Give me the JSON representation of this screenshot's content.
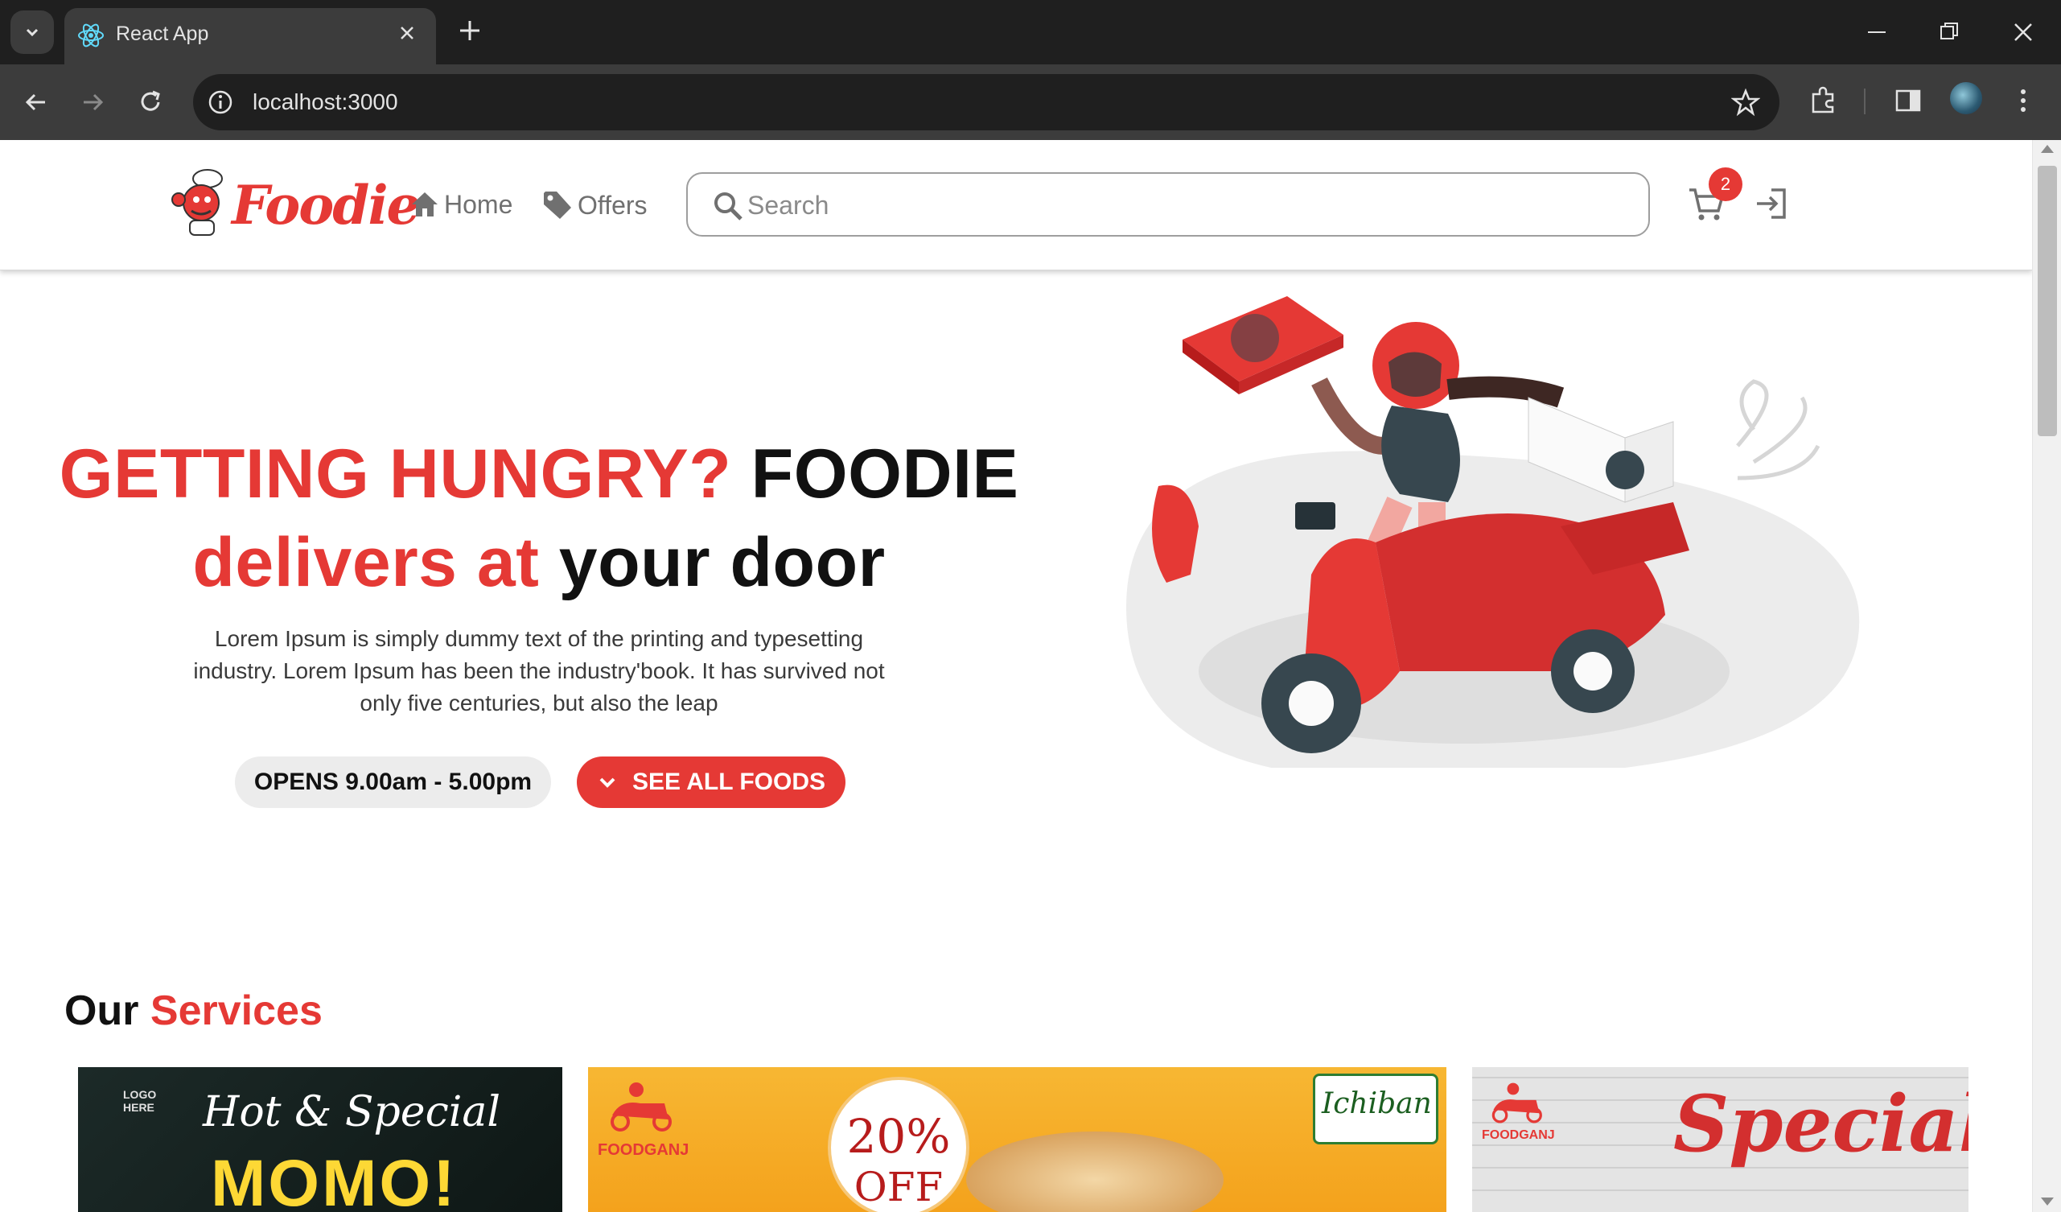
{
  "browser": {
    "tab_title": "React App",
    "url": "localhost:3000"
  },
  "header": {
    "logo_text": "Foodie",
    "nav": [
      {
        "label": "Home",
        "icon": "home-icon"
      },
      {
        "label": "Offers",
        "icon": "tag-icon"
      }
    ],
    "search_placeholder": "Search",
    "cart_count": "2"
  },
  "hero": {
    "title_red_1": "GETTING HUNGRY?",
    "title_black_1": "FOODIE",
    "title_red_2": "delivers at",
    "title_black_2": "your door",
    "description": "Lorem Ipsum is simply dummy text of the printing and typesetting industry. Lorem Ipsum has been the industry'book. It has survived not only five centuries, but also the leap",
    "opens_label": "OPENS 9.00am - 5.00pm",
    "see_all_label": "SEE ALL FOODS"
  },
  "services": {
    "title_black": "Our",
    "title_red": "Services",
    "cards": [
      {
        "text_1": "Hot & Special",
        "text_2": "MOMO!",
        "logo": "LOGO HERE"
      },
      {
        "brand": "FOODGANJ",
        "discount": "20%",
        "off": "OFF",
        "partner": "Ichiban"
      },
      {
        "brand": "FOODGANJ",
        "headline": "Special Burg"
      }
    ]
  },
  "colors": {
    "accent": "#e53935",
    "chrome_dark": "#1f1f1f",
    "chrome_mid": "#3c3c3c"
  }
}
